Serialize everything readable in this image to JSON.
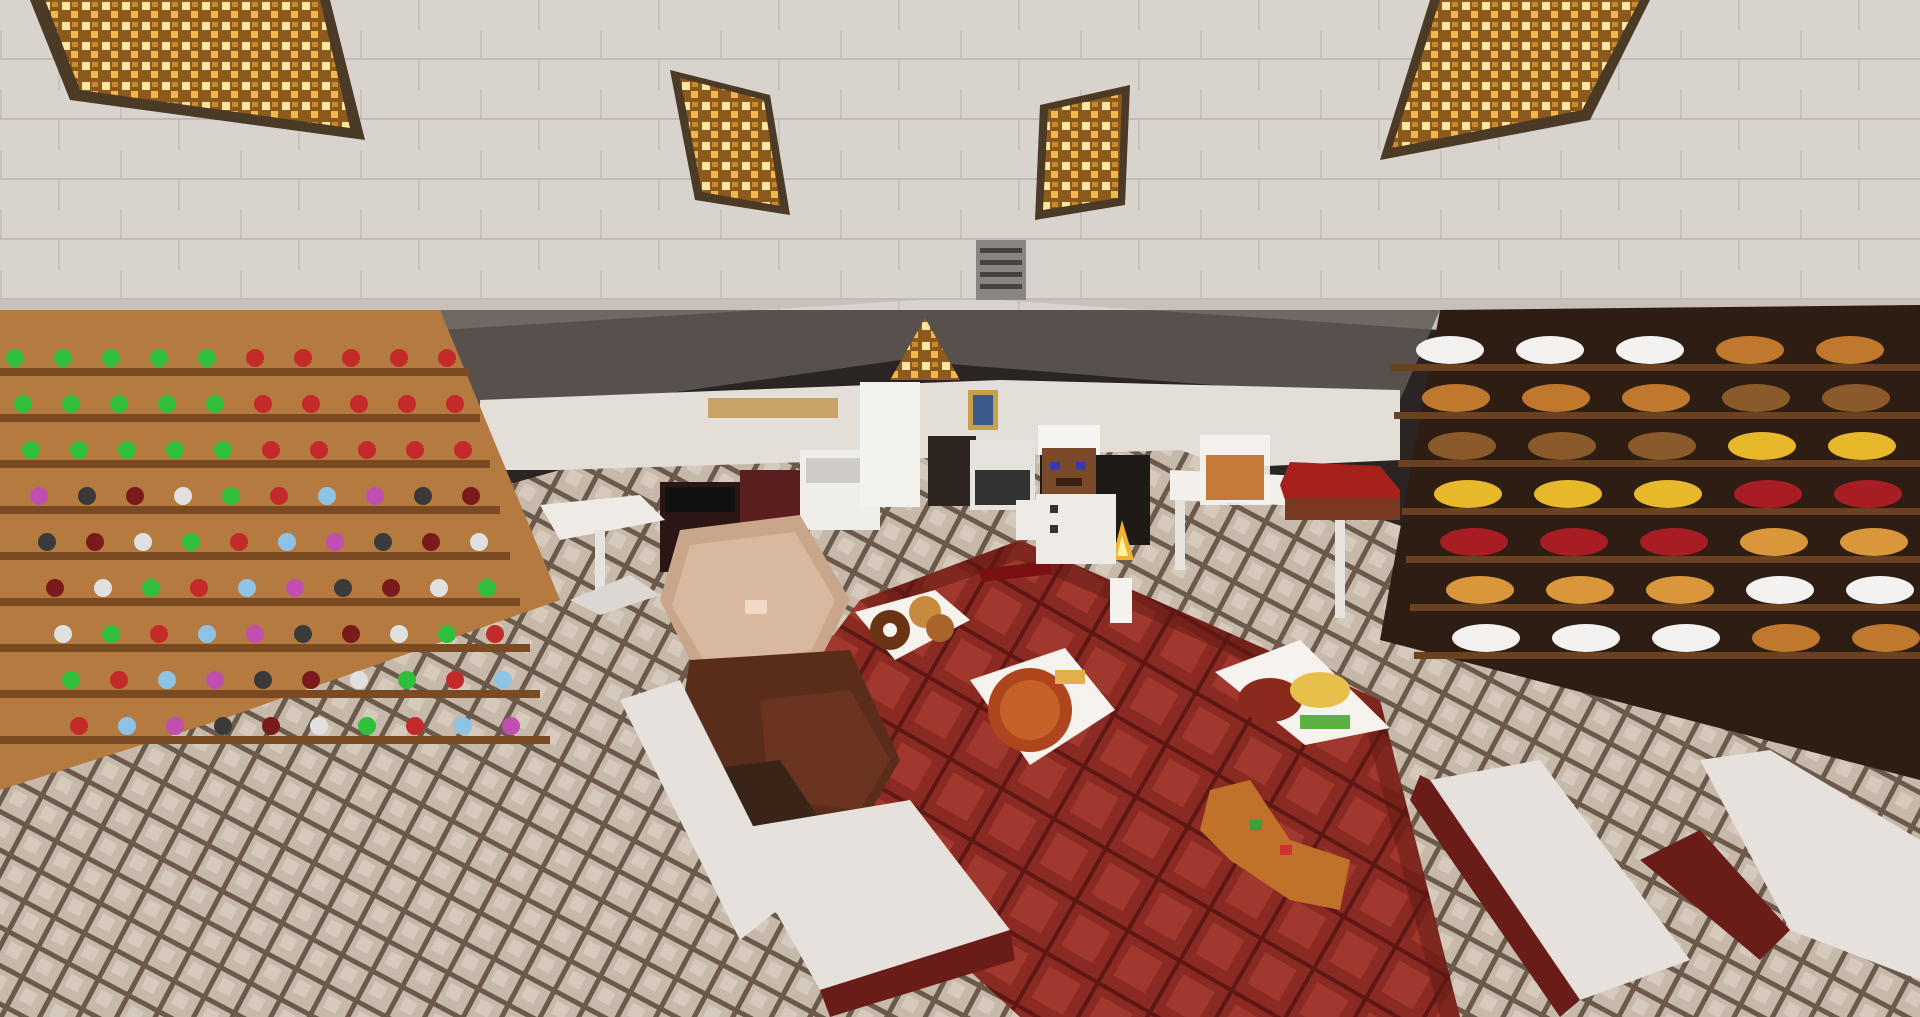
{
  "scene": {
    "setting": "kitchen-dining-room",
    "colors": {
      "wall": "#d9d3ce",
      "wall_shadow": "#6d6560",
      "floor_light": "#c9bcae",
      "floor_dark": "#6b5a4c",
      "table_red": "#8e2d24",
      "shelf_wood": "#a36a34",
      "glowstone": "#f2b64a",
      "chair_white": "#e6e1dc",
      "chair_frame": "#6a1c18"
    },
    "potion_colors": [
      "#2fbf3a",
      "#c42a2a",
      "#8fc3e6",
      "#c04fb0",
      "#3a3a3a",
      "#7a1a1a",
      "#e0e0e0"
    ],
    "shelf_items": [
      "sugar",
      "bread",
      "cocoa",
      "cheese",
      "steak",
      "pie"
    ]
  }
}
